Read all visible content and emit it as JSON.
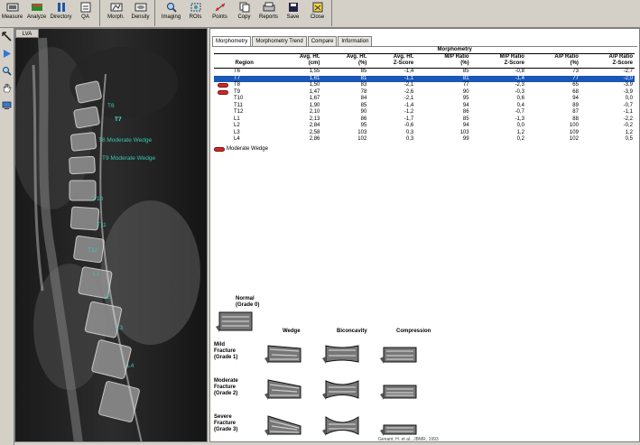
{
  "toolbar": {
    "groups": [
      [
        {
          "label": "Measure",
          "icon": "measure-icon"
        },
        {
          "label": "Analyze",
          "icon": "analyze-icon"
        },
        {
          "label": "Directory",
          "icon": "directory-icon"
        },
        {
          "label": "QA",
          "icon": "qa-icon"
        }
      ],
      [
        {
          "label": "Morph.",
          "icon": "morph-icon"
        },
        {
          "label": "Density",
          "icon": "density-icon"
        }
      ],
      [
        {
          "label": "Imaging",
          "icon": "imaging-icon"
        },
        {
          "label": "ROIs",
          "icon": "rois-icon"
        },
        {
          "label": "Points",
          "icon": "points-icon"
        },
        {
          "label": "Copy",
          "icon": "copy-icon"
        },
        {
          "label": "Reports",
          "icon": "reports-icon"
        },
        {
          "label": "Save",
          "icon": "save-icon"
        },
        {
          "label": "Close",
          "icon": "close-icon"
        }
      ]
    ]
  },
  "image_panel": {
    "tab": "LVA",
    "labels": [
      "T6",
      "T7",
      "T8 Moderate Wedge",
      "T9 Moderate Wedge",
      "T10",
      "T11",
      "T12",
      "L1",
      "L2",
      "L3",
      "L4"
    ]
  },
  "tabs": [
    "Morphometry",
    "Morphometry Trend",
    "Compare",
    "Information"
  ],
  "table": {
    "group_title": "Morphometry",
    "columns": [
      [
        "Region",
        ""
      ],
      [
        "Avg. Ht.",
        "(cm)"
      ],
      [
        "Avg. Ht.",
        "(%)"
      ],
      [
        "Avg. Ht.",
        "Z-Score"
      ],
      [
        "M/P Ratio",
        "(%)"
      ],
      [
        "M/P Ratio",
        "Z-Score"
      ],
      [
        "A/P Ratio",
        "(%)"
      ],
      [
        "A/P Ratio",
        "Z-Score"
      ]
    ],
    "rows": [
      {
        "region": "T6",
        "flag": false,
        "selected": false,
        "vals": [
          "1,55",
          "85",
          "-1,4",
          "85",
          "-0,8",
          "73",
          "-2,7"
        ]
      },
      {
        "region": "T7",
        "flag": false,
        "selected": true,
        "vals": [
          "1,61",
          "81",
          "-1,1",
          "81",
          "-1,4",
          "77",
          "-2,0"
        ]
      },
      {
        "region": "T8",
        "flag": true,
        "selected": false,
        "vals": [
          "1,50",
          "83",
          "-2,1",
          "77",
          "-2,3",
          "65",
          "-3,9"
        ]
      },
      {
        "region": "T9",
        "flag": true,
        "selected": false,
        "vals": [
          "1,47",
          "78",
          "-2,6",
          "90",
          "-0,3",
          "68",
          "-3,9"
        ]
      },
      {
        "region": "T10",
        "flag": false,
        "selected": false,
        "vals": [
          "1,67",
          "84",
          "-2,1",
          "95",
          "0,6",
          "94",
          "0,0"
        ]
      },
      {
        "region": "T11",
        "flag": false,
        "selected": false,
        "vals": [
          "1,90",
          "85",
          "-1,4",
          "94",
          "0,4",
          "89",
          "-0,7"
        ]
      },
      {
        "region": "T12",
        "flag": false,
        "selected": false,
        "vals": [
          "2,10",
          "90",
          "-1,2",
          "86",
          "-0,7",
          "87",
          "-1,1"
        ]
      },
      {
        "region": "L1",
        "flag": false,
        "selected": false,
        "vals": [
          "2,13",
          "86",
          "-1,7",
          "85",
          "-1,3",
          "88",
          "-2,2"
        ]
      },
      {
        "region": "L2",
        "flag": false,
        "selected": false,
        "vals": [
          "2,84",
          "95",
          "-0,6",
          "94",
          "0,0",
          "100",
          "-0,2"
        ]
      },
      {
        "region": "L3",
        "flag": false,
        "selected": false,
        "vals": [
          "2,58",
          "103",
          "0,3",
          "103",
          "1,2",
          "109",
          "1,2"
        ]
      },
      {
        "region": "L4",
        "flag": false,
        "selected": false,
        "vals": [
          "2,86",
          "102",
          "0,3",
          "99",
          "0,2",
          "102",
          "0,5"
        ]
      }
    ]
  },
  "legend": "Moderate Wedge",
  "grading": {
    "normal": [
      "Normal",
      "(Grade 0)"
    ],
    "columns": [
      "Wedge",
      "Biconcavity",
      "Compression"
    ],
    "rows": [
      [
        "Mild",
        "Fracture",
        "(Grade 1)"
      ],
      [
        "Moderate",
        "Fracture",
        "(Grade 2)"
      ],
      [
        "Severe",
        "Fracture",
        "(Grade 3)"
      ]
    ],
    "credit": "Genant, H. et al., JBMR, 1993"
  }
}
